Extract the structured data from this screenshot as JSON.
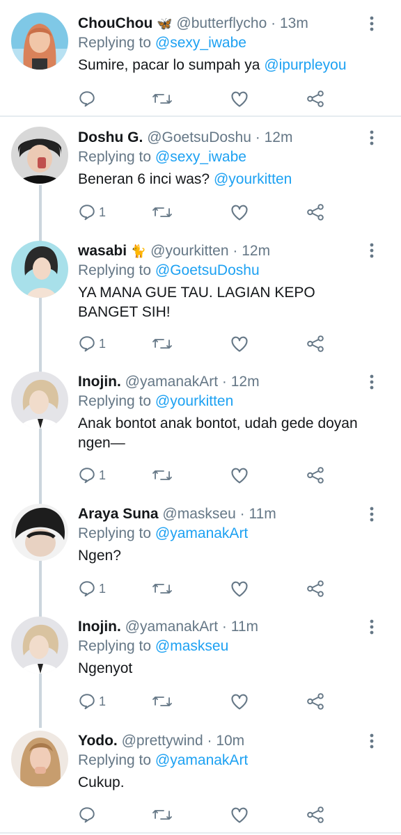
{
  "tweets": [
    {
      "name": "ChouChou",
      "emoji": "🦋",
      "handle": "@butterflycho",
      "time": "13m",
      "replying_prefix": "Replying to",
      "replying_to": "@sexy_iwabe",
      "text_plain": "Sumire, pacar lo sumpah ya",
      "text_mention": "@ipurpleyou",
      "reply_count": ""
    },
    {
      "name": "Doshu G.",
      "emoji": "",
      "handle": "@GoetsuDoshu",
      "time": "12m",
      "replying_prefix": "Replying to",
      "replying_to": "@sexy_iwabe",
      "text_plain": "Beneran 6 inci was?",
      "text_mention": "@yourkitten",
      "reply_count": "1"
    },
    {
      "name": "wasabi",
      "emoji": "🐈",
      "handle": "@yourkitten",
      "time": "12m",
      "replying_prefix": "Replying to",
      "replying_to": "@GoetsuDoshu",
      "text_plain": "YA MANA GUE TAU. LAGIAN KEPO BANGET SIH!",
      "text_mention": "",
      "reply_count": "1"
    },
    {
      "name": "Inojin.",
      "emoji": "",
      "handle": "@yamanakArt",
      "time": "12m",
      "replying_prefix": "Replying to",
      "replying_to": "@yourkitten",
      "text_plain": "Anak bontot anak bontot, udah gede doyan ngen—",
      "text_mention": "",
      "reply_count": "1"
    },
    {
      "name": "Araya Suna",
      "emoji": "",
      "handle": "@maskseu",
      "time": "11m",
      "replying_prefix": "Replying to",
      "replying_to": "@yamanakArt",
      "text_plain": "Ngen?",
      "text_mention": "",
      "reply_count": "1"
    },
    {
      "name": "Inojin.",
      "emoji": "",
      "handle": "@yamanakArt",
      "time": "11m",
      "replying_prefix": "Replying to",
      "replying_to": "@maskseu",
      "text_plain": "Ngenyot",
      "text_mention": "",
      "reply_count": "1"
    },
    {
      "name": "Yodo.",
      "emoji": "",
      "handle": "@prettywind",
      "time": "10m",
      "replying_prefix": "Replying to",
      "replying_to": "@yamanakArt",
      "text_plain": "Cukup.",
      "text_mention": "",
      "reply_count": ""
    }
  ],
  "separator_dot": "·",
  "icons": {
    "reply": "reply-icon",
    "retweet": "retweet-icon",
    "like": "heart-icon",
    "share": "share-icon",
    "more": "more-vertical-icon"
  },
  "colors": {
    "link": "#1da1f2",
    "secondary": "#657786",
    "text": "#14171a",
    "divider": "#e6ecf0",
    "thread_line": "#ccd6dd"
  }
}
